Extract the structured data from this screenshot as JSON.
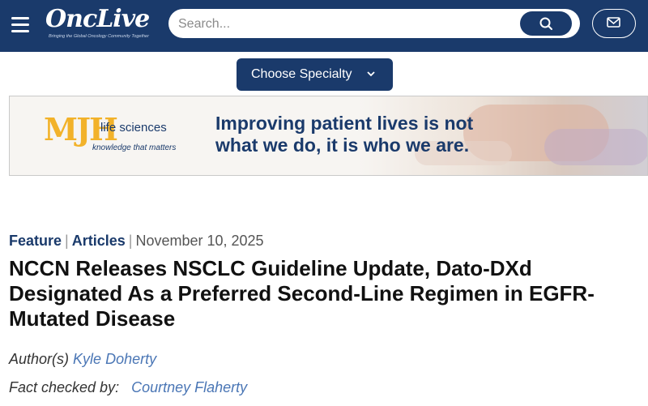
{
  "header": {
    "logo_text": "OncLive",
    "logo_tagline": "Bringing the Global Oncology Community Together",
    "search_placeholder": "Search...",
    "search_icon": "search-icon",
    "mail_icon": "mail-icon",
    "menu_icon": "hamburger-menu-icon",
    "bg_color": "#1a3a6b"
  },
  "specialty": {
    "label": "Choose Specialty",
    "icon": "chevron-down-icon"
  },
  "banner": {
    "brand_mark": "MJH",
    "brand_name": "life sciences",
    "brand_tagline": "knowledge that matters",
    "headline": "Improving patient lives is not what we do, it is who we are.",
    "accent_color": "#f2b22a"
  },
  "article": {
    "category_1": "Feature",
    "category_2": "Articles",
    "date": "November 10, 2025",
    "title": "NCCN Releases NSCLC Guideline Update, Dato-DXd Designated As a Preferred Second-Line Regimen in EGFR-Mutated Disease",
    "authors_label": "Author(s)",
    "author": "Kyle Doherty",
    "fact_checked_label": "Fact checked by:",
    "fact_checker": "Courtney Flaherty",
    "link_color": "#4a76b5"
  }
}
